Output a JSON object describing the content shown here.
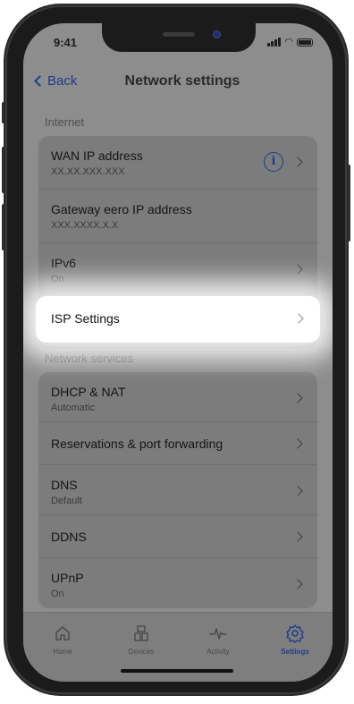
{
  "status_bar": {
    "time": "9:41"
  },
  "header": {
    "back_label": "Back",
    "title": "Network settings"
  },
  "sections": {
    "internet": {
      "label": "Internet",
      "rows": [
        {
          "title": "WAN IP address",
          "subtitle": "XX.XX.XXX.XXX"
        },
        {
          "title": "Gateway eero IP address",
          "subtitle": "XXX.XXXX.X.X"
        },
        {
          "title": "IPv6",
          "subtitle": "On"
        },
        {
          "title": "ISP Settings"
        }
      ]
    },
    "network_services": {
      "label": "Network services",
      "rows": [
        {
          "title": "DHCP & NAT",
          "subtitle": "Automatic"
        },
        {
          "title": "Reservations & port forwarding"
        },
        {
          "title": "DNS",
          "subtitle": "Default"
        },
        {
          "title": "DDNS"
        },
        {
          "title": "UPnP",
          "subtitle": "On"
        }
      ]
    }
  },
  "tabbar": {
    "items": [
      {
        "label": "Home",
        "icon": "home-icon"
      },
      {
        "label": "Devices",
        "icon": "devices-icon"
      },
      {
        "label": "Activity",
        "icon": "activity-icon"
      },
      {
        "label": "Settings",
        "icon": "gear-icon"
      }
    ],
    "active": "Settings"
  },
  "colors": {
    "accent": "#1f3d8c",
    "overlay": "#8d8d8d",
    "highlight": "#ffffff"
  }
}
